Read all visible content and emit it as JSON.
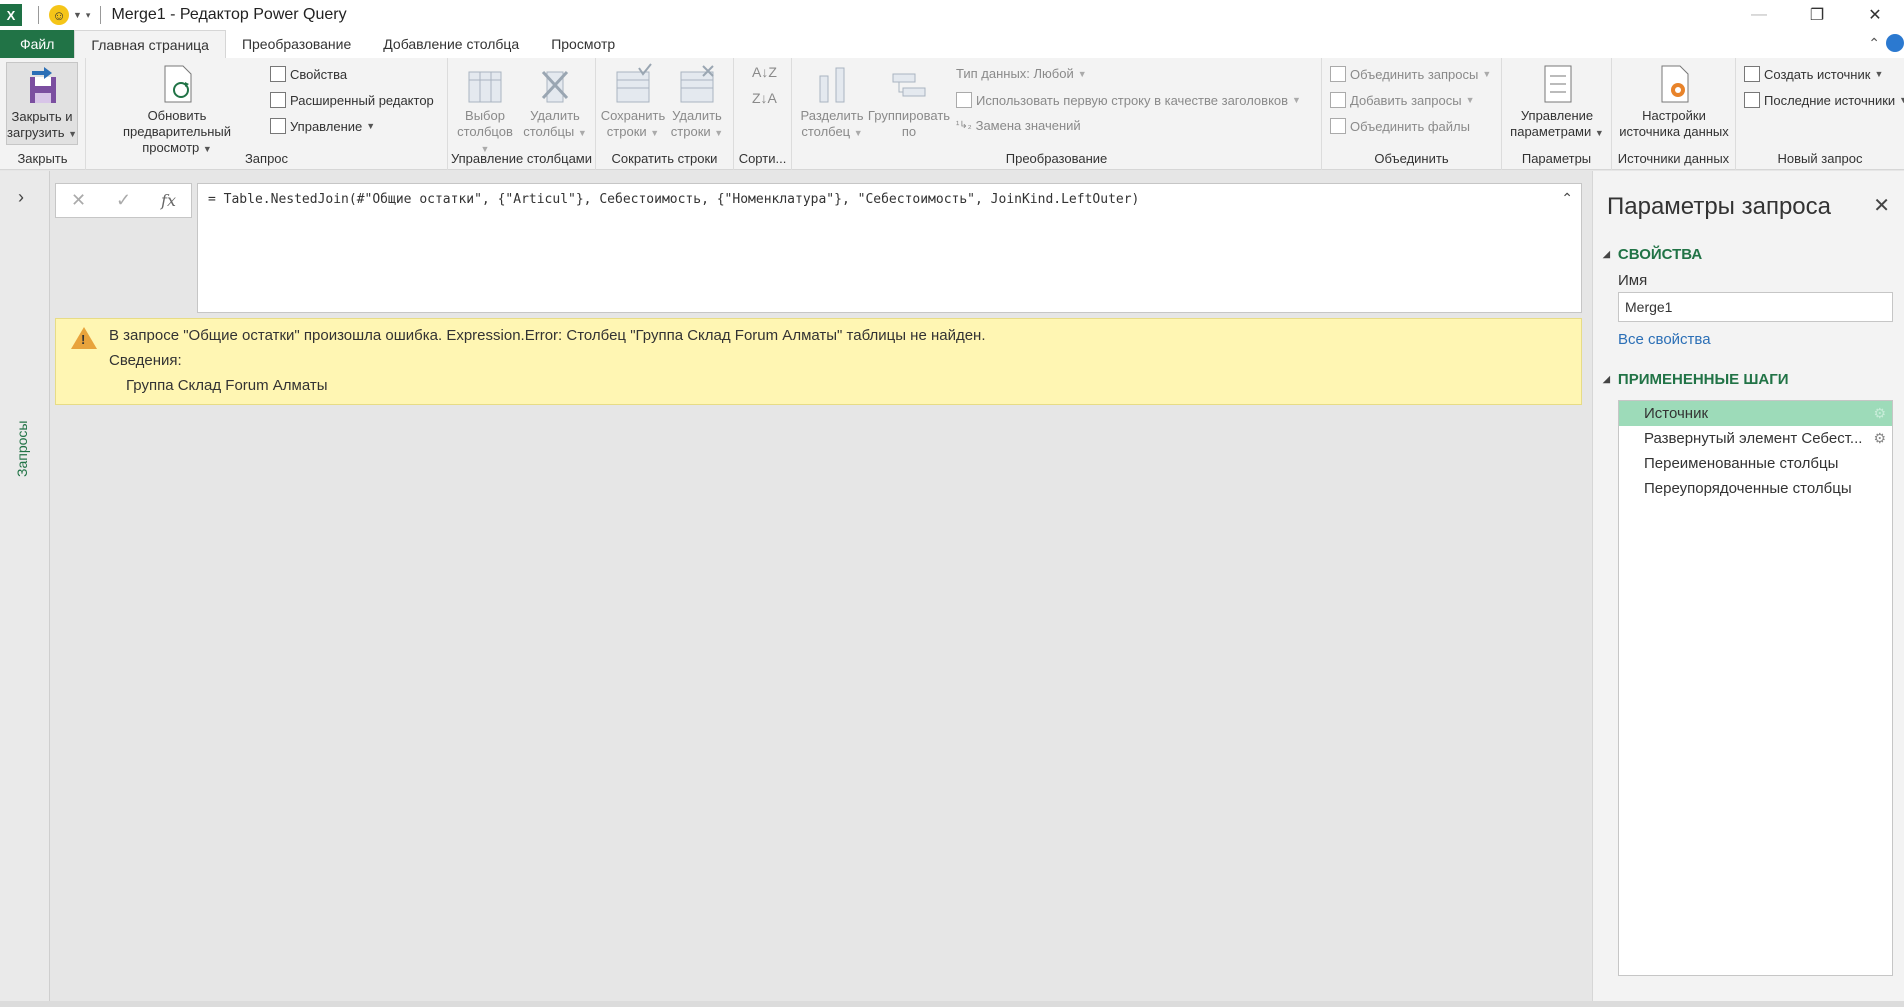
{
  "window": {
    "title": "Merge1 - Редактор Power Query",
    "app_icon": "excel-icon",
    "qat_icon": "smiley-icon"
  },
  "tabs": [
    {
      "label": "Файл"
    },
    {
      "label": "Главная страница"
    },
    {
      "label": "Преобразование"
    },
    {
      "label": "Добавление столбца"
    },
    {
      "label": "Просмотр"
    }
  ],
  "ribbon": {
    "close": {
      "button": "Закрыть и загрузить",
      "label1": "Закрыть и",
      "label2": "загрузить",
      "group": "Закрыть"
    },
    "query": {
      "refresh1": "Обновить предварительный",
      "refresh2": "просмотр",
      "properties": "Свойства",
      "advanced_editor": "Расширенный редактор",
      "manage": "Управление",
      "group": "Запрос"
    },
    "manage_columns": {
      "choose1": "Выбор",
      "choose2": "столбцов",
      "remove1": "Удалить",
      "remove2": "столбцы",
      "group": "Управление столбцами"
    },
    "reduce_rows": {
      "keep1": "Сохранить",
      "keep2": "строки",
      "remove1": "Удалить",
      "remove2": "строки",
      "group": "Сократить строки"
    },
    "sort": {
      "group": "Сорти..."
    },
    "transform": {
      "split1": "Разделить",
      "split2": "столбец",
      "group1": "Группировать",
      "group2": "по",
      "data_type": "Тип данных: Любой",
      "first_row": "Использовать первую строку в качестве заголовков",
      "replace": "Замена значений",
      "group": "Преобразование"
    },
    "combine": {
      "merge": "Объединить запросы",
      "append": "Добавить запросы",
      "files": "Объединить файлы",
      "group": "Объединить"
    },
    "parameters": {
      "manage1": "Управление",
      "manage2": "параметрами",
      "group": "Параметры"
    },
    "data_sources": {
      "settings1": "Настройки",
      "settings2": "источника данных",
      "group": "Источники данных"
    },
    "new_query": {
      "new_source": "Создать источник",
      "recent": "Последние источники",
      "group": "Новый запрос"
    }
  },
  "queries_pane": {
    "label": "Запросы"
  },
  "formula_bar": {
    "text": "= Table.NestedJoin(#\"Общие остатки\", {\"Articul\"}, Себестоимость, {\"Номенклатура\"}, \"Себестоимость\", JoinKind.LeftOuter)"
  },
  "error": {
    "line1": "В запросе \"Общие остатки\" произошла ошибка. Expression.Error: Столбец \"Группа Склад Forum Алматы\" таблицы не найден.",
    "line2": "Сведения:",
    "line3": "Группа Склад Forum Алматы"
  },
  "settings_pane": {
    "title": "Параметры запроса",
    "properties_header": "СВОЙСТВА",
    "name_label": "Имя",
    "name_value": "Merge1",
    "all_properties": "Все свойства",
    "steps_header": "ПРИМЕНЕННЫЕ ШАГИ",
    "steps": [
      {
        "label": "Источник",
        "selected": true,
        "gear": true
      },
      {
        "label": "Развернутый элемент Себест...",
        "selected": false,
        "gear": true
      },
      {
        "label": "Переименованные столбцы",
        "selected": false,
        "gear": false
      },
      {
        "label": "Переупорядоченные столбцы",
        "selected": false,
        "gear": false
      }
    ]
  },
  "colors": {
    "accent": "#217346",
    "selected_step": "#9ddbb9",
    "error_bg": "#fff6b3"
  }
}
